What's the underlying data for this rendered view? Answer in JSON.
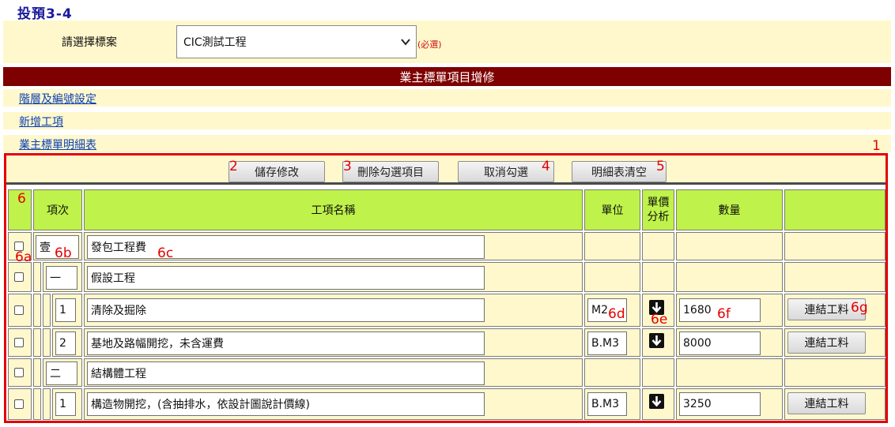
{
  "page_title": "投預3-4",
  "project_select": {
    "label": "請選擇標案",
    "value": "CIC測試工程",
    "required_note": "(必選)"
  },
  "section_title": "業主標單項目增修",
  "nav_links": [
    "階層及編號設定",
    "新增工項",
    "業主標單明細表"
  ],
  "toolbar": {
    "save_label": "儲存修改",
    "delete_label": "刪除勾選項目",
    "uncheck_label": "取消勾選",
    "clear_label": "明細表清空"
  },
  "table": {
    "headers": {
      "item_no": "項次",
      "name": "工項名稱",
      "unit": "單位",
      "price_analysis_1": "單價",
      "price_analysis_2": "分析",
      "quantity": "數量"
    },
    "rows": [
      {
        "item_no": "壹",
        "name": "發包工程費",
        "unit": "",
        "quantity": "",
        "link": ""
      },
      {
        "item_no": "一",
        "name": "假設工程",
        "unit": "",
        "quantity": "",
        "link": ""
      },
      {
        "item_no": "1",
        "name": "清除及掘除",
        "unit": "M2",
        "quantity": "1680",
        "link": "連結工料"
      },
      {
        "item_no": "2",
        "name": "基地及路幅開挖，未含運費",
        "unit": "B.M3",
        "quantity": "8000",
        "link": "連結工料"
      },
      {
        "item_no": "二",
        "name": "結構體工程",
        "unit": "",
        "quantity": "",
        "link": ""
      },
      {
        "item_no": "1",
        "name": "構造物開挖，(含抽排水，依設計圖說計價線)",
        "unit": "B.M3",
        "quantity": "3250",
        "link": "連結工料"
      }
    ]
  },
  "annotations": {
    "frame": "1",
    "save": "2",
    "delete": "3",
    "uncheck": "4",
    "clear": "5",
    "table": "6",
    "checkbox": "6a",
    "item_no": "6b",
    "name": "6c",
    "unit": "6d",
    "analysis": "6e",
    "quantity": "6f",
    "link": "6g"
  },
  "colors": {
    "title_blue": "#1a1a9c",
    "section_bar": "#7f0000",
    "row_bg": "#fff8cc",
    "header_green": "#bff24a",
    "annotation_red": "#e50000",
    "link_blue": "#0b3fb5"
  },
  "icons": {
    "dropdown": "chevron-down-icon",
    "price_analysis": "arrow-down-icon"
  }
}
